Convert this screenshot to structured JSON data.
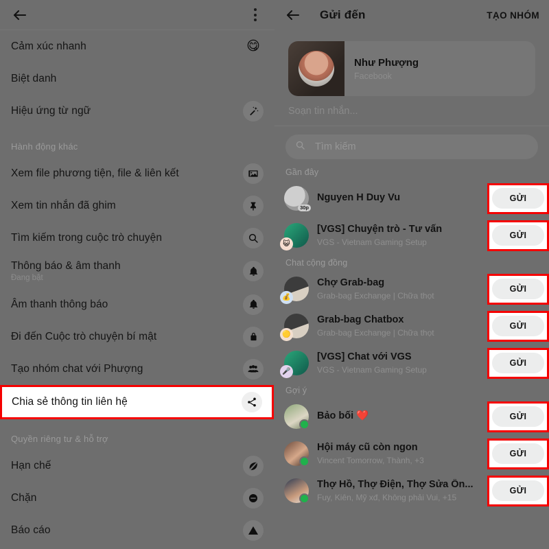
{
  "left_panel": {
    "header": {
      "back_icon": "back-arrow-icon",
      "menu_icon": "kebab-menu-icon"
    },
    "rows": [
      {
        "type": "item",
        "label": "Cảm xúc nhanh",
        "icon": "emoji-smiling-face-icon",
        "glyph": "😋"
      },
      {
        "type": "item",
        "label": "Biệt danh",
        "icon": "none",
        "glyph": ""
      },
      {
        "type": "item",
        "label": "Hiệu ứng từ ngữ",
        "icon": "magic-wand-icon",
        "glyph": ""
      },
      {
        "type": "section",
        "label": "Hành động khác"
      },
      {
        "type": "item",
        "label": "Xem file phương tiện, file & liên kết",
        "icon": "media-image-icon"
      },
      {
        "type": "item",
        "label": "Xem tin nhắn đã ghim",
        "icon": "pin-icon"
      },
      {
        "type": "item",
        "label": "Tìm kiếm trong cuộc trò chuyện",
        "icon": "search-icon"
      },
      {
        "type": "item",
        "label": "Thông báo & âm thanh",
        "sub": "Đang bật",
        "icon": "bell-icon"
      },
      {
        "type": "item",
        "label": "Âm thanh thông báo",
        "icon": "bell-icon"
      },
      {
        "type": "item",
        "label": "Đi đến Cuộc trò chuyện bí mật",
        "icon": "lock-icon"
      },
      {
        "type": "item",
        "label": "Tạo nhóm chat với Phượng",
        "icon": "people-group-icon"
      },
      {
        "type": "item",
        "label": "Chia sẻ thông tin liên hệ",
        "icon": "share-icon",
        "highlighted": true
      },
      {
        "type": "section",
        "label": "Quyền riêng tư & hỗ trợ"
      },
      {
        "type": "item",
        "label": "Hạn chế",
        "icon": "restrict-slashed-leaf-icon"
      },
      {
        "type": "item",
        "label": "Chặn",
        "icon": "block-circle-icon"
      },
      {
        "type": "item",
        "label": "Báo cáo",
        "icon": "warning-triangle-icon"
      }
    ]
  },
  "right_panel": {
    "header": {
      "back_icon": "back-arrow-icon",
      "title": "Gửi đến",
      "action_label": "TẠO NHÓM"
    },
    "share_card": {
      "name": "Như Phượng",
      "platform": "Facebook"
    },
    "compose_placeholder": "Soạn tin nhắn...",
    "search": {
      "icon": "search-icon",
      "placeholder": "Tìm kiếm"
    },
    "send_label": "GỬI",
    "sections": [
      {
        "label": "Gần đây",
        "items": [
          {
            "name": "Nguyen H Duy Vu",
            "sub": "",
            "badge": "30p",
            "online": false,
            "av_css": "background:radial-gradient(circle at 40% 38%, #cfcfcf 0 52%, #9d9d9d 53% 100%);",
            "mini": ""
          },
          {
            "name": "[VGS] Chuyện trò - Tư vấn",
            "sub": "VGS - Vietnam Gaming Setup",
            "badge": "",
            "online": false,
            "av_css": "background:linear-gradient(135deg,#2aa87a,#10584a);",
            "mini": "😺",
            "mini_css": "background:#f6ddd0;"
          }
        ]
      },
      {
        "label": "Chat cộng đồng",
        "items": [
          {
            "name": "Chợ Grab-bag",
            "sub": "Grab-bag Exchange | Chữa thọt",
            "badge": "",
            "online": false,
            "av_css": "background:linear-gradient(160deg,#3c3c3c 0 55%,#d8cfc2 56% 100%);",
            "mini": "💰",
            "mini_css": "background:#cfe0f3;"
          },
          {
            "name": "Grab-bag Chatbox",
            "sub": "Grab-bag Exchange | Chữa thọt",
            "badge": "",
            "online": false,
            "av_css": "background:linear-gradient(160deg,#3c3c3c 0 55%,#d8cfc2 56% 100%);",
            "mini": "🟡",
            "mini_css": "background:#f3dfcf;"
          },
          {
            "name": "[VGS] Chat với VGS",
            "sub": "VGS - Vietnam Gaming Setup",
            "badge": "",
            "online": false,
            "av_css": "background:linear-gradient(135deg,#2aa87a,#10584a);",
            "mini": "🎤",
            "mini_css": "background:#e3d3ee;"
          }
        ]
      },
      {
        "label": "Gợi ý",
        "items": [
          {
            "name": "Bảo bối ❤️",
            "sub": "",
            "badge": "",
            "online": true,
            "av_css": "background:linear-gradient(150deg,#8ea87a,#dcd6c4 60%,#6f7f5e);",
            "mini": ""
          },
          {
            "name": "Hội máy cũ còn ngon",
            "sub": "Vincent Tomorrow, Thành, +3",
            "badge": "",
            "online": true,
            "av_css": "background:linear-gradient(140deg,#6b4a3c,#d6a88a 55%,#3a2a22);",
            "mini": ""
          },
          {
            "name": "Thợ Hồ, Thợ Điện, Thợ Sửa Ốn...",
            "sub": "Fuy, Kiên, Mỹ xđ, Không phải Vui, +15",
            "badge": "",
            "online": true,
            "av_css": "background:linear-gradient(150deg,#2c3a52,#c79a7c 60%,#e8e2da);",
            "mini": ""
          }
        ]
      }
    ]
  },
  "colors": {
    "dim_overlay": "#6e6e6e",
    "highlight_red": "#f50000",
    "online_green": "#20b14c",
    "card_white": "#ffffff"
  }
}
